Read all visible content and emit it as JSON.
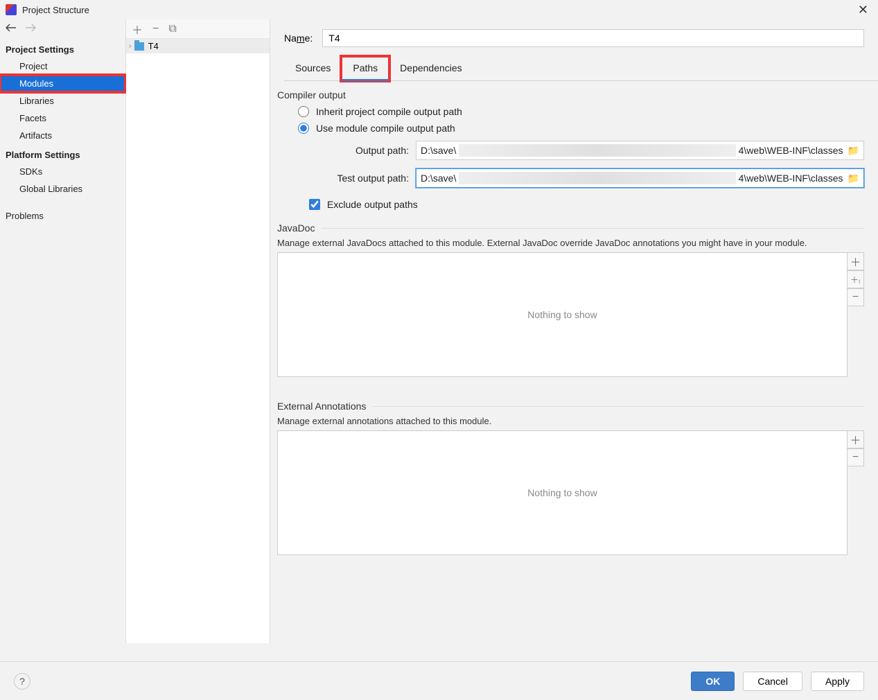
{
  "window": {
    "title": "Project Structure"
  },
  "sidebar": {
    "sections": {
      "project": {
        "title": "Project Settings",
        "items": [
          "Project",
          "Modules",
          "Libraries",
          "Facets",
          "Artifacts"
        ],
        "selected": "Modules"
      },
      "platform": {
        "title": "Platform Settings",
        "items": [
          "SDKs",
          "Global Libraries"
        ]
      },
      "problems": {
        "title": "Problems"
      }
    }
  },
  "tree": {
    "module": "T4"
  },
  "module": {
    "name_label": "Name:",
    "name_value": "T4",
    "tabs": {
      "sources": "Sources",
      "paths": "Paths",
      "deps": "Dependencies",
      "active": "paths"
    }
  },
  "compiler": {
    "section": "Compiler output",
    "inherit": "Inherit project compile output path",
    "usemodule": "Use module compile output path",
    "selected": "usemodule",
    "output_label": "Output path:",
    "output_pre": "D:\\save\\",
    "output_post": "4\\web\\WEB-INF\\classes",
    "test_label": "Test output path:",
    "test_pre": "D:\\save\\",
    "test_post": "4\\web\\WEB-INF\\classes",
    "exclude": "Exclude output paths",
    "exclude_checked": true
  },
  "javadoc": {
    "title": "JavaDoc",
    "desc": "Manage external JavaDocs attached to this module. External JavaDoc override JavaDoc annotations you might have in your module.",
    "empty": "Nothing to show"
  },
  "extann": {
    "title": "External Annotations",
    "desc": "Manage external annotations attached to this module.",
    "empty": "Nothing to show"
  },
  "footer": {
    "ok": "OK",
    "cancel": "Cancel",
    "apply": "Apply"
  }
}
